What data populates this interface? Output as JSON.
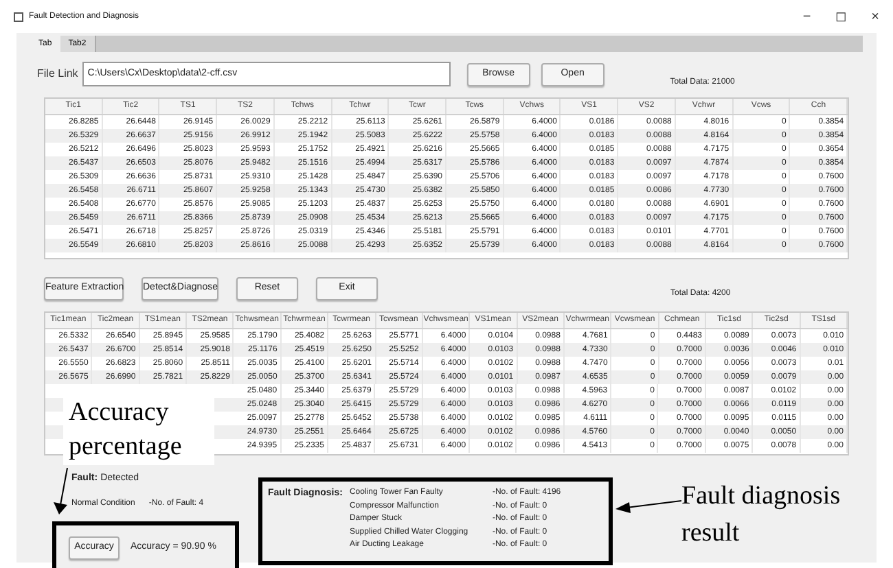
{
  "window": {
    "title": "Fault Detection and Diagnosis",
    "controls": [
      "−",
      "◻",
      "×"
    ]
  },
  "tabs": [
    {
      "label": "Tab",
      "selected": true
    },
    {
      "label": "Tab2",
      "selected": false
    }
  ],
  "file_link": {
    "label": "File Link",
    "value": "C:\\Users\\Cx\\Desktop\\data\\2-cff.csv"
  },
  "file_buttons": [
    "Browse",
    "Open"
  ],
  "raw_table": {
    "total": "Total Data:  21000",
    "columns": [
      "Tic1",
      "Tic2",
      "TS1",
      "TS2",
      "Tchws",
      "Tchwr",
      "Tcwr",
      "Tcws",
      "Vchws",
      "VS1",
      "VS2",
      "Vchwr",
      "Vcws",
      "Cch"
    ],
    "rows": [
      [
        "26.8285",
        "26.6448",
        "26.9145",
        "26.0029",
        "25.2212",
        "25.6113",
        "25.6261",
        "26.5879",
        "6.4000",
        "0.0186",
        "0.0088",
        "4.8016",
        "0",
        "0.3854"
      ],
      [
        "26.5329",
        "26.6637",
        "25.9156",
        "26.9912",
        "25.1942",
        "25.5083",
        "25.6222",
        "25.5758",
        "6.4000",
        "0.0183",
        "0.0088",
        "4.8164",
        "0",
        "0.3854"
      ],
      [
        "26.5212",
        "26.6496",
        "25.8023",
        "25.9593",
        "25.1752",
        "25.4921",
        "25.6216",
        "25.5665",
        "6.4000",
        "0.0185",
        "0.0088",
        "4.7175",
        "0",
        "0.3654"
      ],
      [
        "26.5437",
        "26.6503",
        "25.8076",
        "25.9482",
        "25.1516",
        "25.4994",
        "25.6317",
        "25.5786",
        "6.4000",
        "0.0183",
        "0.0097",
        "4.7874",
        "0",
        "0.3854"
      ],
      [
        "26.5309",
        "26.6636",
        "25.8731",
        "25.9310",
        "25.1428",
        "25.4847",
        "25.6390",
        "25.5706",
        "6.4000",
        "0.0183",
        "0.0097",
        "4.7178",
        "0",
        "0.7600"
      ],
      [
        "26.5458",
        "26.6711",
        "25.8607",
        "25.9258",
        "25.1343",
        "25.4730",
        "25.6382",
        "25.5850",
        "6.4000",
        "0.0185",
        "0.0086",
        "4.7730",
        "0",
        "0.7600"
      ],
      [
        "26.5408",
        "26.6770",
        "25.8576",
        "25.9085",
        "25.1203",
        "25.4837",
        "25.6253",
        "25.5750",
        "6.4000",
        "0.0180",
        "0.0088",
        "4.6901",
        "0",
        "0.7600"
      ],
      [
        "26.5459",
        "26.6711",
        "25.8366",
        "25.8739",
        "25.0908",
        "25.4534",
        "25.6213",
        "25.5665",
        "6.4000",
        "0.0183",
        "0.0097",
        "4.7175",
        "0",
        "0.7600"
      ],
      [
        "26.5471",
        "26.6718",
        "25.8257",
        "25.8726",
        "25.0319",
        "25.4346",
        "25.5181",
        "25.5791",
        "6.4000",
        "0.0183",
        "0.0101",
        "4.7701",
        "0",
        "0.7600"
      ],
      [
        "26.5549",
        "26.6810",
        "25.8203",
        "25.8616",
        "25.0088",
        "25.4293",
        "25.6352",
        "25.5739",
        "6.4000",
        "0.0183",
        "0.0088",
        "4.8164",
        "0",
        "0.7600"
      ]
    ]
  },
  "actions": [
    "Feature Extraction",
    "Detect&Diagnose",
    "Reset",
    "Exit"
  ],
  "feature_table": {
    "total": "Total Data:  4200",
    "columns": [
      "Tic1mean",
      "Tic2mean",
      "TS1mean",
      "TS2mean",
      "Tchwsmean",
      "Tchwrmean",
      "Tcwrmean",
      "Tcwsmean",
      "Vchwsmean",
      "VS1mean",
      "VS2mean",
      "Vchwrmean",
      "Vcwsmean",
      "Cchmean",
      "Tic1sd",
      "Tic2sd",
      "TS1sd"
    ],
    "rows": [
      [
        "26.5332",
        "26.6540",
        "25.8945",
        "25.9585",
        "25.1790",
        "25.4082",
        "25.6263",
        "25.5771",
        "6.4000",
        "0.0104",
        "0.0988",
        "4.7681",
        "0",
        "0.4483",
        "0.0089",
        "0.0073",
        "0.010"
      ],
      [
        "26.5437",
        "26.6700",
        "25.8514",
        "25.9018",
        "25.1176",
        "25.4519",
        "25.6250",
        "25.5252",
        "6.4000",
        "0.0103",
        "0.0988",
        "4.7330",
        "0",
        "0.7000",
        "0.0036",
        "0.0046",
        "0.010"
      ],
      [
        "26.5550",
        "26.6823",
        "25.8060",
        "25.8511",
        "25.0035",
        "25.4100",
        "25.6201",
        "25.5714",
        "6.4000",
        "0.0102",
        "0.0988",
        "4.7470",
        "0",
        "0.7000",
        "0.0056",
        "0.0073",
        "0.01"
      ],
      [
        "26.5675",
        "26.6990",
        "25.7821",
        "25.8229",
        "25.0050",
        "25.3700",
        "25.6341",
        "25.5724",
        "6.4000",
        "0.0101",
        "0.0987",
        "4.6535",
        "0",
        "0.7000",
        "0.0059",
        "0.0079",
        "0.00"
      ],
      [
        "25.0480",
        "25.3440",
        "25.6379",
        "25.5729",
        "6.4000",
        "0.0103",
        "0.0988",
        "4.5963",
        "0",
        "0.7000",
        "0.0087",
        "0.0102",
        "0.00"
      ],
      [
        "25.0248",
        "25.3040",
        "25.6415",
        "25.5729",
        "6.4000",
        "0.0103",
        "0.0986",
        "4.6270",
        "0",
        "0.7000",
        "0.0066",
        "0.0119",
        "0.00"
      ],
      [
        "25.0097",
        "25.2778",
        "25.6452",
        "25.5738",
        "6.4000",
        "0.0102",
        "0.0985",
        "4.6111",
        "0",
        "0.7000",
        "0.0095",
        "0.0115",
        "0.00"
      ],
      [
        "24.9730",
        "25.2551",
        "25.6464",
        "25.6725",
        "6.4000",
        "0.0102",
        "0.0986",
        "4.5760",
        "0",
        "0.7000",
        "0.0040",
        "0.0050",
        "0.00"
      ],
      [
        "24.9395",
        "25.2335",
        "25.4837",
        "25.6731",
        "6.4000",
        "0.0102",
        "0.0986",
        "4.5413",
        "0",
        "0.7000",
        "0.0075",
        "0.0078",
        "0.00"
      ]
    ]
  },
  "fault": {
    "label": "Fault:",
    "value": "Detected"
  },
  "normal": {
    "label": "Normal Condition",
    "count": "-No. of Fault: 4"
  },
  "accuracy": {
    "button": "Accuracy",
    "value": "Accuracy = 90.90 %"
  },
  "diagnosis": {
    "label": "Fault Diagnosis:",
    "items": [
      {
        "name": "Cooling Tower Fan Faulty",
        "count": "-No. of Fault: 4196"
      },
      {
        "name": "Compressor Malfunction",
        "count": "-No. of Fault: 0"
      },
      {
        "name": "Damper Stuck",
        "count": "-No. of Fault: 0"
      },
      {
        "name": "Supplied Chilled Water Clogging",
        "count": "-No. of Fault: 0"
      },
      {
        "name": "Air Ducting Leakage",
        "count": "-No. of Fault: 0"
      }
    ]
  },
  "annotations": [
    {
      "kind": "accuracy",
      "text": "Accuracy percentage"
    },
    {
      "kind": "diagnosis",
      "text": "Fault diagnosis result"
    }
  ]
}
